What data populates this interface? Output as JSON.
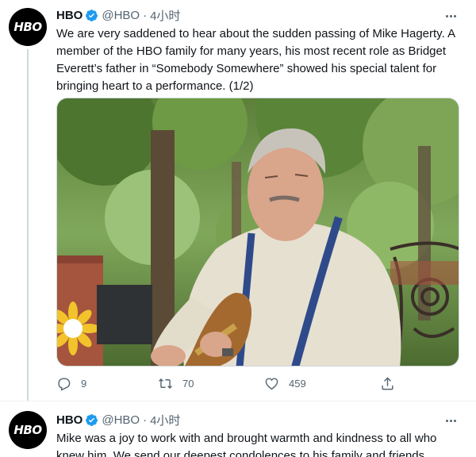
{
  "tweets": [
    {
      "name": "HBO",
      "avatar_text": "HBO",
      "handle": "@HBO",
      "separator": "·",
      "time": "4小时",
      "text": "We are very saddened to hear about the sudden passing of Mike Hagerty. A member of the HBO family for many years, his most recent role as Bridget Everett’s father in “Somebody Somewhere” showed his special talent for bringing heart to a performance. (1/2)",
      "replies": "9",
      "retweets": "70",
      "likes": "459"
    },
    {
      "name": "HBO",
      "avatar_text": "HBO",
      "handle": "@HBO",
      "separator": "·",
      "time": "4小时",
      "text": "Mike was a joy to work with and brought warmth and kindness to all who knew him. We send our deepest condolences to his family and friends."
    }
  ],
  "icons": {
    "verified": "verified-badge-icon",
    "more": "more-horizontal-icon",
    "reply": "reply-icon",
    "retweet": "retweet-icon",
    "like": "heart-icon",
    "share": "share-icon"
  },
  "colors": {
    "verified": "#1d9bf0",
    "secondary_text": "#536471",
    "primary_text": "#0f1419",
    "thread_line": "#cfd9de"
  }
}
